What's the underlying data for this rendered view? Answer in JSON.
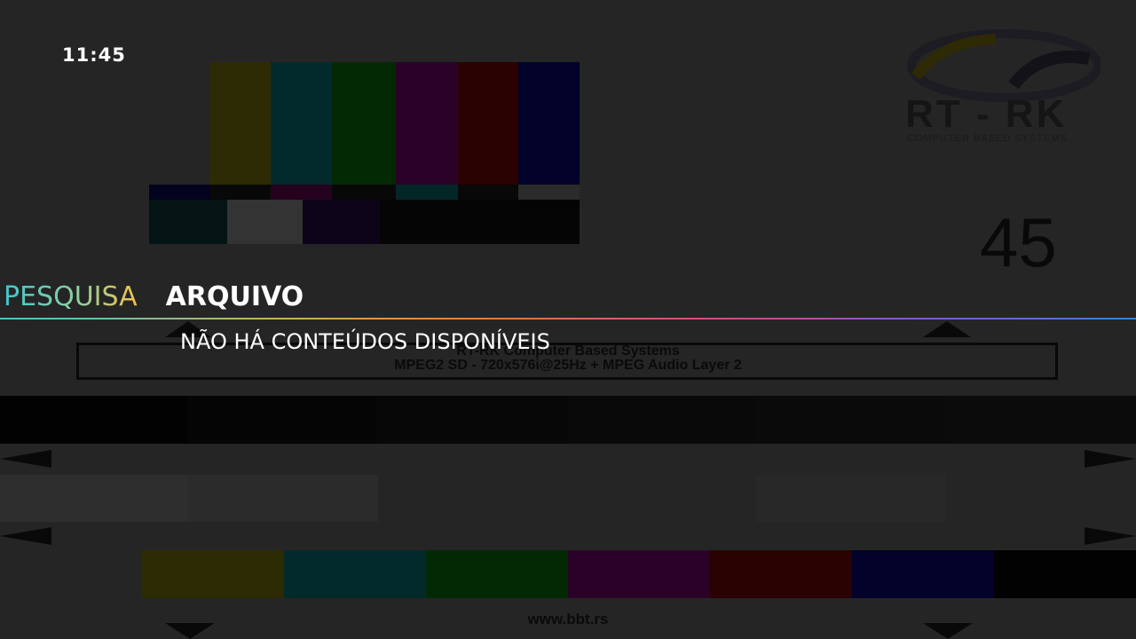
{
  "status": {
    "clock": "11:45"
  },
  "tabs": [
    {
      "label": "PESQUISA",
      "active": false
    },
    {
      "label": "ARQUIVO",
      "active": true
    }
  ],
  "content": {
    "empty_message": "NÃO HÁ CONTEÚDOS DISPONÍVEIS"
  },
  "background_pattern": {
    "logo_text": "RT - RK",
    "logo_tagline": "COMPUTER BASED SYSTEMS",
    "channel_number": "45",
    "info_line1": "RT-RK Computer Based Systems",
    "info_line2": "MPEG2 SD - 720x576i@25Hz + MPEG Audio Layer 2",
    "website": "www.bbt.rs"
  },
  "colors": {
    "tab_gradient_start": "#3fc7c9",
    "tab_gradient_end": "#f2c24a",
    "active_tab": "#ffffff",
    "divider_gradient": [
      "#3fc7c9",
      "#e0843a",
      "#d94a7c",
      "#7a5ccf",
      "#3b7fd9"
    ]
  }
}
